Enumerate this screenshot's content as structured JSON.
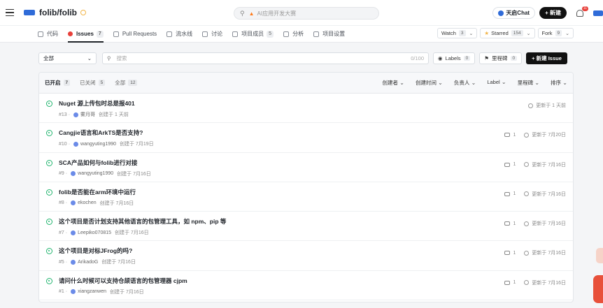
{
  "topbar": {
    "repo": "folib/folib",
    "search_placeholder": "AI应用开发大赛",
    "chat_label": "天启Chat",
    "new_label": "+ 新建",
    "notification_count": "11"
  },
  "tabs": [
    {
      "label": "代码",
      "count": ""
    },
    {
      "label": "Issues",
      "count": "7"
    },
    {
      "label": "Pull Requests",
      "count": ""
    },
    {
      "label": "流水线",
      "count": ""
    },
    {
      "label": "讨论",
      "count": ""
    },
    {
      "label": "项目成员",
      "count": "5"
    },
    {
      "label": "分析",
      "count": ""
    },
    {
      "label": "项目设置",
      "count": ""
    }
  ],
  "repo_actions": {
    "watch": {
      "label": "Watch",
      "count": "3"
    },
    "starred": {
      "label": "Starred",
      "count": "154"
    },
    "fork": {
      "label": "Fork",
      "count": "9"
    }
  },
  "filter": {
    "select_value": "全部",
    "search_placeholder": "搜索",
    "search_counter": "0/100",
    "labels": {
      "label": "Labels",
      "count": "0"
    },
    "milestones": {
      "label": "里程碑",
      "count": "0"
    },
    "new_issue": "+ 新建 Issue"
  },
  "panel": {
    "states": [
      {
        "label": "已开启",
        "count": "7"
      },
      {
        "label": "已关闭",
        "count": "5"
      },
      {
        "label": "全部",
        "count": "12"
      }
    ],
    "sorts": [
      "创建者",
      "创建时间",
      "负责人",
      "Label",
      "里程碑",
      "排序"
    ]
  },
  "issues": [
    {
      "title": "Nuget 源上传包时总是报401",
      "number": "#13",
      "user": "雾月哥",
      "created": "创建于 1 天前",
      "comments": "",
      "updated": "更新于 1 天前"
    },
    {
      "title": "Cangjie语言和ArkTS是否支持?",
      "number": "#10",
      "user": "wangyuting1990",
      "created": "创建于 7月19日",
      "comments": "1",
      "updated": "更新于 7月20日"
    },
    {
      "title": "SCA产品如何与folib进行对接",
      "number": "#9",
      "user": "wangyuting1990",
      "created": "创建于 7月16日",
      "comments": "1",
      "updated": "更新于 7月16日"
    },
    {
      "title": "folib是否能在arm环境中运行",
      "number": "#8",
      "user": "ekochen",
      "created": "创建于 7月16日",
      "comments": "1",
      "updated": "更新于 7月16日"
    },
    {
      "title": "这个项目是否计划支持其他语言的包管理工具，如 npm、pip 等",
      "number": "#7",
      "user": "Leepiko070815",
      "created": "创建于 7月16日",
      "comments": "1",
      "updated": "更新于 7月16日"
    },
    {
      "title": "这个项目是对标JFrog的吗?",
      "number": "#5",
      "user": "ArikadoG",
      "created": "创建于 7月16日",
      "comments": "1",
      "updated": "更新于 7月16日"
    },
    {
      "title": "请问什么时候可以支持仓颉语言的包管理器 cjpm",
      "number": "#1",
      "user": "xiangzanwen",
      "created": "创建于 7月16日",
      "comments": "1",
      "updated": "更新于 7月16日"
    }
  ]
}
